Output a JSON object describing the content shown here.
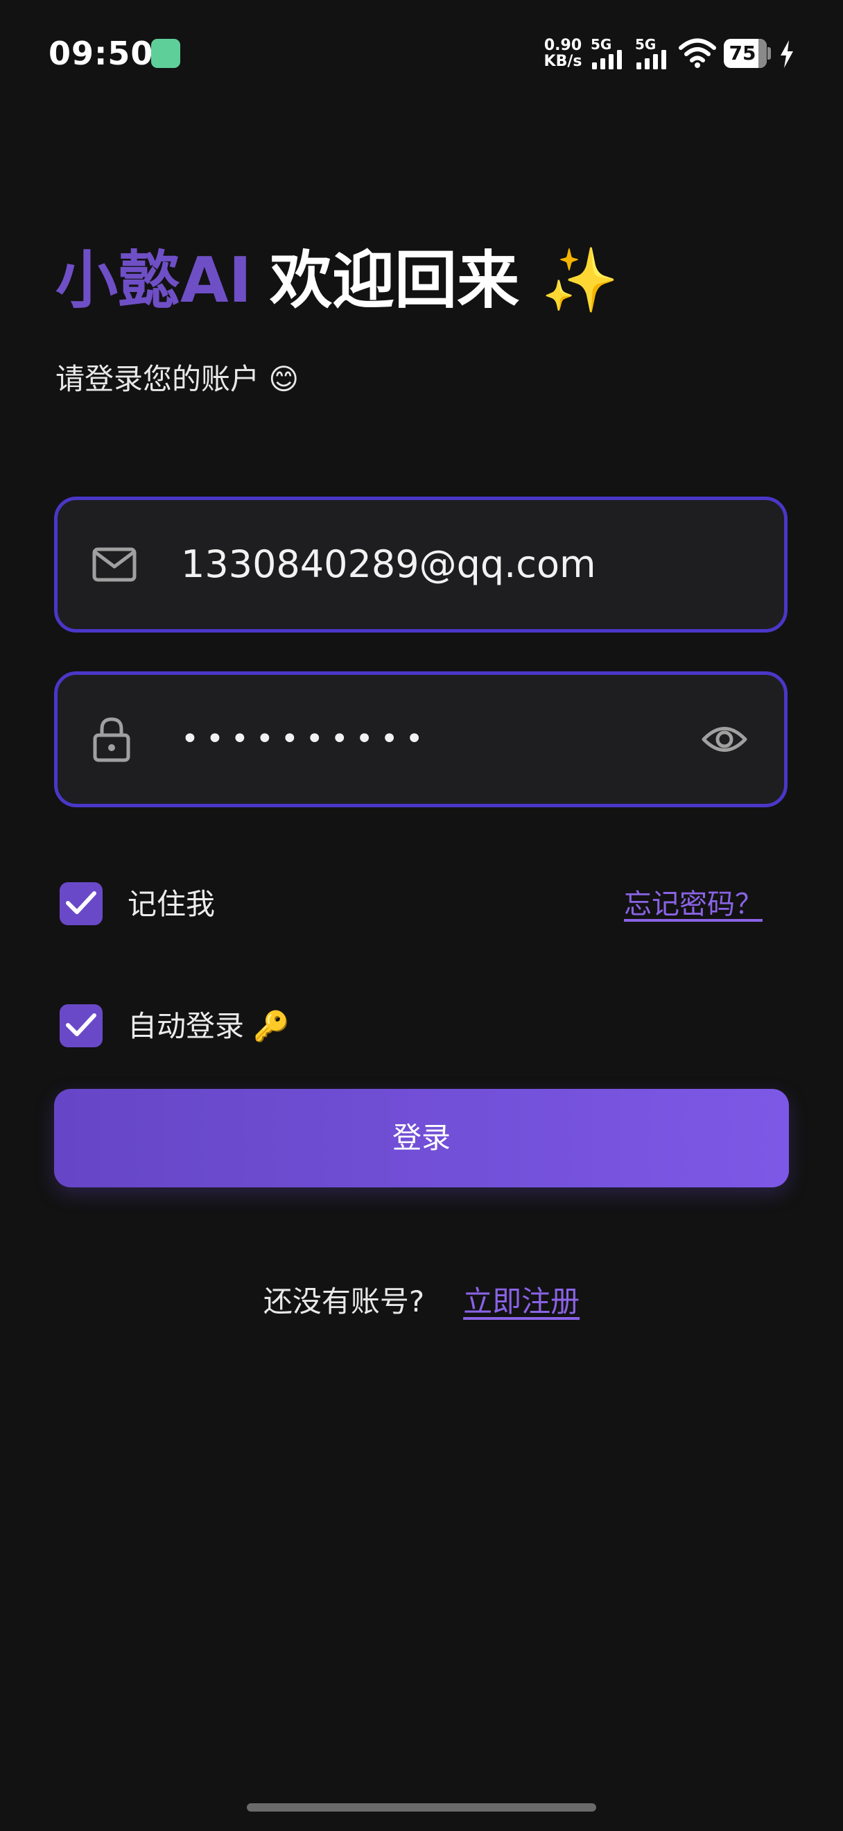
{
  "status_bar": {
    "time": "09:50",
    "net_speed_value": "0.90",
    "net_speed_unit": "KB/s",
    "sim1_label": "5G",
    "sim2_label": "5G",
    "battery_level": "75",
    "charging": true
  },
  "header": {
    "brand": "小懿AI",
    "welcome": "欢迎回来 ✨",
    "subtitle": "请登录您的账户 😊"
  },
  "form": {
    "email_value": "1330840289@qq.com",
    "password_masked": "••••••••••",
    "remember_me_label": "记住我",
    "remember_me_checked": true,
    "auto_login_label": "自动登录 🔑",
    "auto_login_checked": true,
    "forgot_password_label": "忘记密码？",
    "login_button_label": "登录"
  },
  "footer": {
    "no_account_text": "还没有账号?",
    "register_link_label": "立即注册"
  },
  "colors": {
    "background": "#121212",
    "accent": "#7d58e6",
    "input_border": "#4a37c8",
    "brand_text": "#6f4fc6"
  }
}
